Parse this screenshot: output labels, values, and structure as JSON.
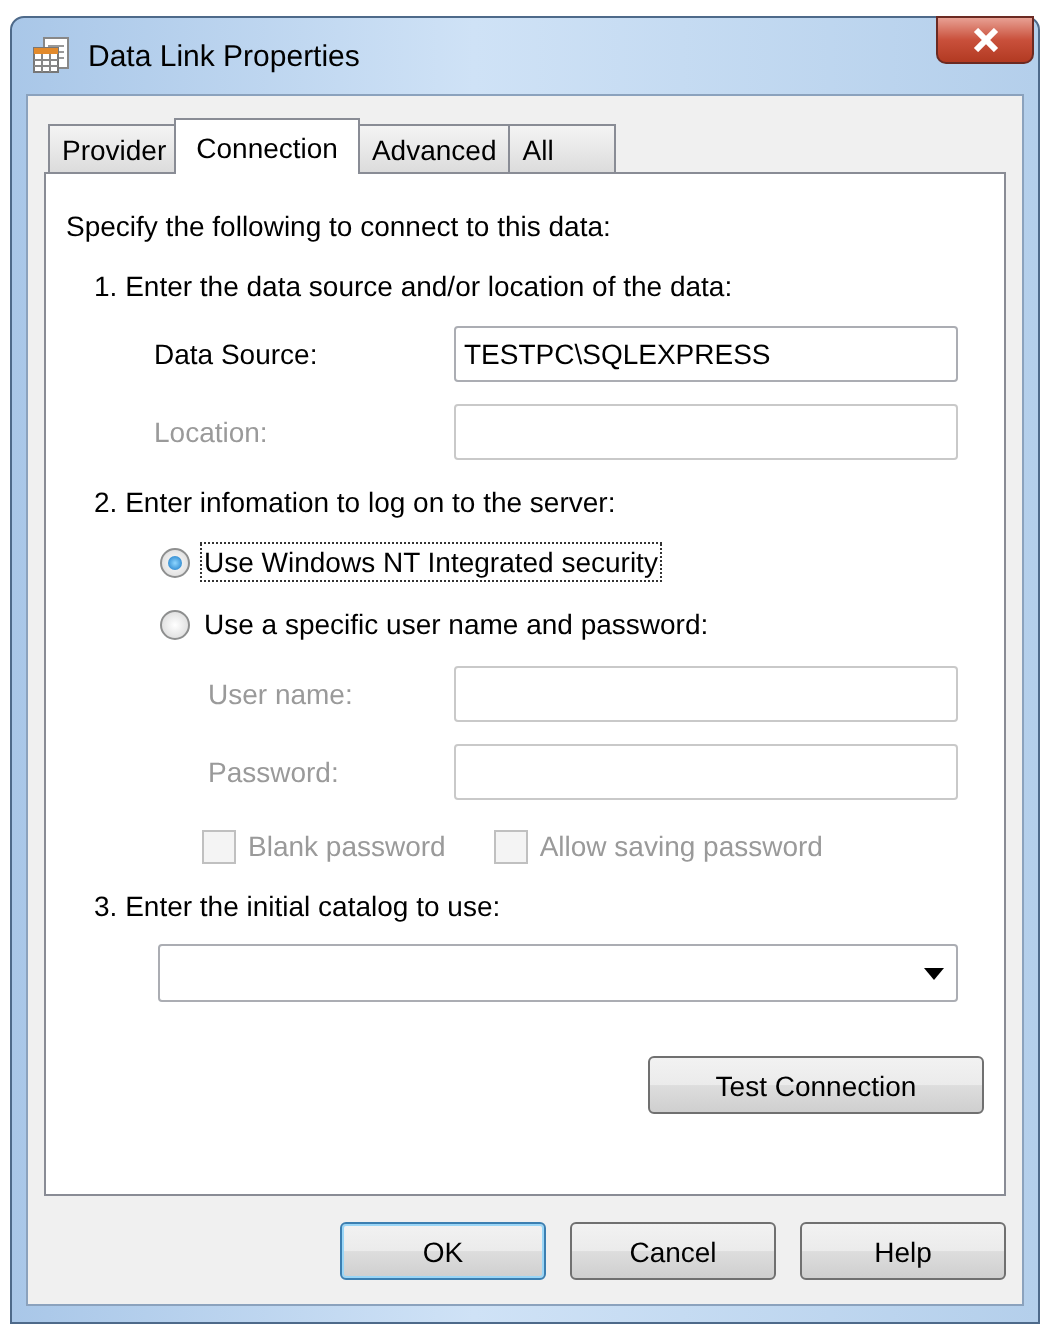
{
  "window": {
    "title": "Data Link Properties"
  },
  "tabs": [
    {
      "label": "Provider",
      "selected": false
    },
    {
      "label": "Connection",
      "selected": true
    },
    {
      "label": "Advanced",
      "selected": false
    },
    {
      "label": "All",
      "selected": false
    }
  ],
  "intro": "Specify the following to connect to this data:",
  "step1": {
    "heading": "1. Enter the data source and/or location of the data:",
    "fields": [
      {
        "label": "Data Source:",
        "value": "TESTPC\\SQLEXPRESS",
        "disabled": false
      },
      {
        "label": "Location:",
        "disabled": true
      }
    ]
  },
  "step2": {
    "heading": "2. Enter infomation to log on to the server:",
    "options": [
      {
        "label": "Use Windows NT Integrated security",
        "selected": true
      },
      {
        "label": "Use a specific user name and password:",
        "selected": false
      }
    ],
    "fields": [
      {
        "label": "User name:",
        "disabled": true
      },
      {
        "label": "Password:",
        "disabled": true
      }
    ],
    "checkboxes": [
      {
        "label": "Blank password",
        "checked": false,
        "disabled": true
      },
      {
        "label": "Allow saving password",
        "checked": false,
        "disabled": true
      }
    ]
  },
  "step3": {
    "heading": "3. Enter the initial catalog to use:"
  },
  "test_button": {
    "label": "Test Connection"
  },
  "buttons": [
    {
      "label": "OK",
      "default": true
    },
    {
      "label": "Cancel",
      "default": false
    },
    {
      "label": "Help",
      "default": false
    }
  ]
}
